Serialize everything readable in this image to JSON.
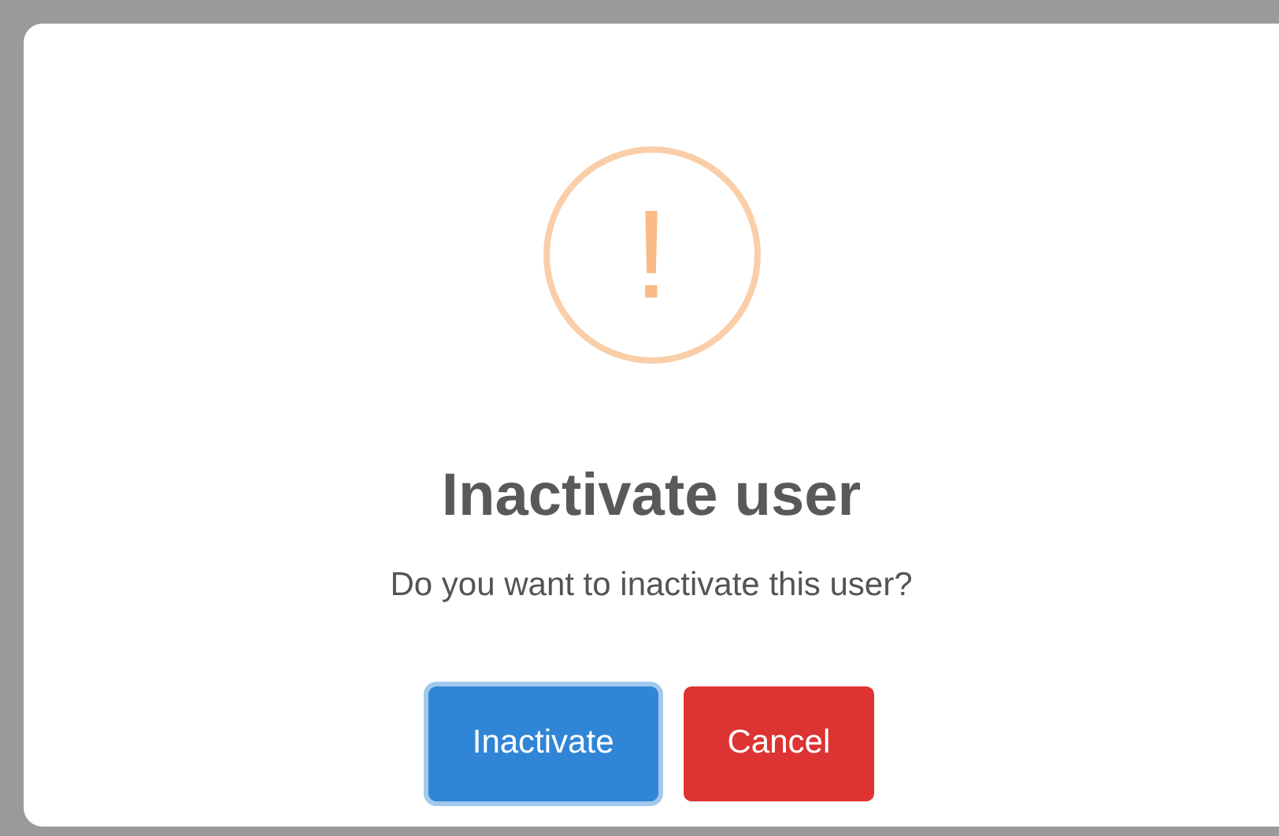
{
  "dialog": {
    "icon": "!",
    "title": "Inactivate user",
    "message": "Do you want to inactivate this user?",
    "buttons": [
      {
        "label": "Inactivate",
        "kind": "confirm",
        "focused": true
      },
      {
        "label": "Cancel",
        "kind": "cancel",
        "focused": false
      }
    ]
  }
}
